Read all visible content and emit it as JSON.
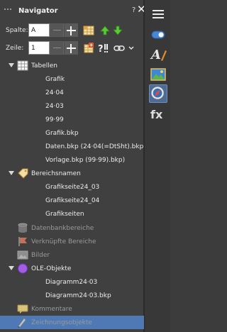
{
  "panel": {
    "title": "Navigator",
    "help": "?",
    "close": "✕"
  },
  "controls": {
    "column_label": "Spalte:",
    "column_value": "A",
    "row_label": "Zeile:",
    "row_value": "1"
  },
  "tree": {
    "tabellen": "Tabellen",
    "tables": [
      "Grafik",
      "24·04",
      "24·03",
      "99·99",
      "Grafik.bkp",
      "Daten.bkp (24·04(=DtSht).bkp)",
      "Vorlage.bkp (99·99).bkp)"
    ],
    "bereichsnamen": "Bereichsnamen",
    "ranges": [
      "Grafikseite24_03",
      "Grafikseite24_04",
      "Grafikseiten"
    ],
    "datenbankbereiche": "Datenbankbereiche",
    "verknuepfte_bereiche": "Verknüpfte Bereiche",
    "bilder": "Bilder",
    "ole_objekte": "OLE-Objekte",
    "ole_items": [
      "Diagramm24·03",
      "Diagramm24·03.bkp"
    ],
    "kommentare": "Kommentare",
    "zeichnungsobjekte": "Zeichnungsobjekte"
  },
  "colors": {
    "selection": "#4f79b5",
    "accent": "#4d6b93"
  }
}
